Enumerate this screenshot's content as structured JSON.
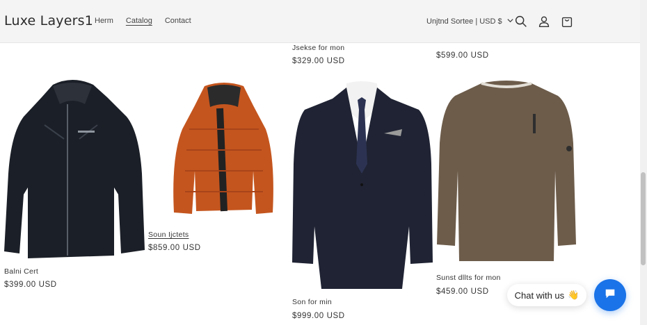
{
  "header": {
    "logo": "Luxe Layers1",
    "nav": [
      "Herm",
      "Catalog",
      "Contact"
    ],
    "active_nav": "Catalog",
    "country_selector": "Unjtnd Sortee | USD $"
  },
  "icons": [
    "search-icon",
    "account-icon",
    "cart-icon",
    "chevron-down-icon",
    "chat-icon",
    "wave-emoji-icon"
  ],
  "products_top": [
    {
      "name": "Jsekse for mon",
      "price": "$329.00 USD"
    },
    {
      "name": "",
      "price": "$599.00 USD"
    }
  ],
  "products": [
    {
      "name": "Balni Cert",
      "price": "$399.00 USD"
    },
    {
      "name": "Soun Ijctets",
      "price": "$859.00 USD"
    },
    {
      "name": "Son for min",
      "price": "$999.00 USD"
    },
    {
      "name": "Sunst dllts for mon",
      "price": "$459.00 USD"
    }
  ],
  "chat": {
    "label": "Chat with us",
    "emoji": "👋"
  },
  "colors": {
    "header_bg": "#f4f4f4",
    "chat_blue": "#1a73e8",
    "text": "#333333"
  }
}
